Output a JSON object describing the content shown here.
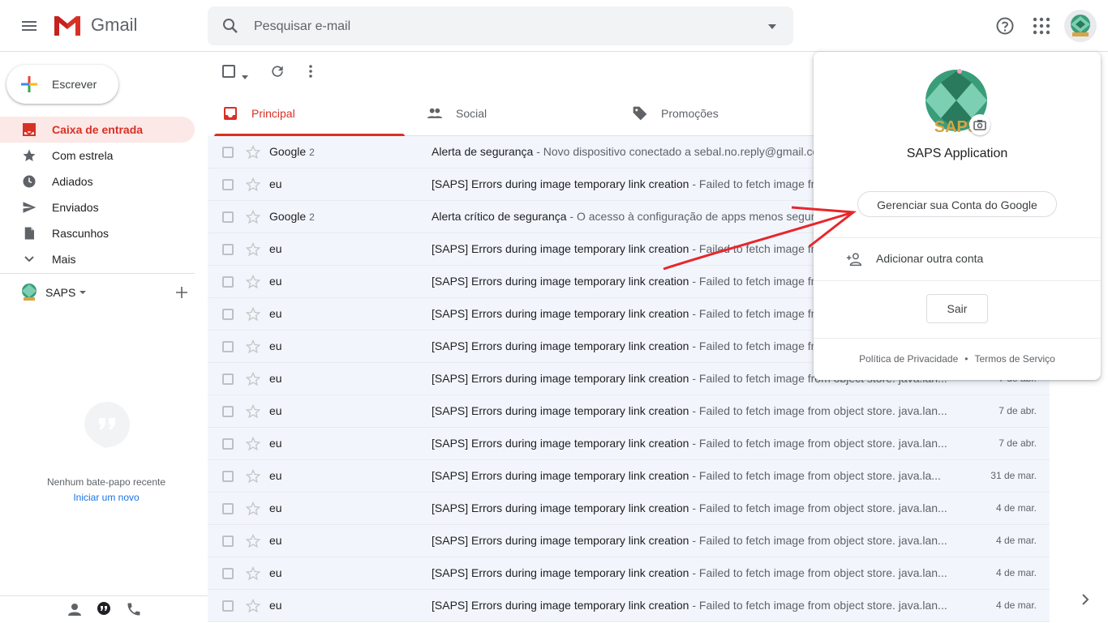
{
  "header": {
    "app_name": "Gmail",
    "search_placeholder": "Pesquisar e-mail"
  },
  "sidebar": {
    "compose_label": "Escrever",
    "items": [
      {
        "label": "Caixa de entrada",
        "icon": "inbox-icon",
        "active": true
      },
      {
        "label": "Com estrela",
        "icon": "star-icon"
      },
      {
        "label": "Adiados",
        "icon": "clock-icon"
      },
      {
        "label": "Enviados",
        "icon": "send-icon"
      },
      {
        "label": "Rascunhos",
        "icon": "draft-icon"
      },
      {
        "label": "Mais",
        "icon": "chevron-down-icon"
      }
    ],
    "account_label": "SAPS",
    "chat_empty": "Nenhum bate-papo recente",
    "chat_new": "Iniciar um novo"
  },
  "tabs": [
    {
      "label": "Principal",
      "icon": "inbox-icon",
      "active": true
    },
    {
      "label": "Social",
      "icon": "people-icon"
    },
    {
      "label": "Promoções",
      "icon": "tag-icon"
    }
  ],
  "emails": [
    {
      "sender": "Google",
      "count": "2",
      "subject": "Alerta de segurança",
      "snippet": " - Novo dispositivo conectado a sebal.no.reply@gmail.com",
      "date": ""
    },
    {
      "sender": "eu",
      "count": "",
      "subject": "[SAPS] Errors during image temporary link creation",
      "snippet": " - Failed to fetch image from object store. java.lan...",
      "date": ""
    },
    {
      "sender": "Google",
      "count": "2",
      "subject": "Alerta crítico de segurança",
      "snippet": " - O acesso à configuração de apps menos seguros",
      "date": ""
    },
    {
      "sender": "eu",
      "count": "",
      "subject": "[SAPS] Errors during image temporary link creation",
      "snippet": " - Failed to fetch image from object store. java.lan...",
      "date": ""
    },
    {
      "sender": "eu",
      "count": "",
      "subject": "[SAPS] Errors during image temporary link creation",
      "snippet": " - Failed to fetch image from object store. java.lan...",
      "date": ""
    },
    {
      "sender": "eu",
      "count": "",
      "subject": "[SAPS] Errors during image temporary link creation",
      "snippet": " - Failed to fetch image from object store. java.lan...",
      "date": ""
    },
    {
      "sender": "eu",
      "count": "",
      "subject": "[SAPS] Errors during image temporary link creation",
      "snippet": " - Failed to fetch image from object store. java.lan...",
      "date": ""
    },
    {
      "sender": "eu",
      "count": "",
      "subject": "[SAPS] Errors during image temporary link creation",
      "snippet": " - Failed to fetch image from object store. java.lan...",
      "date": "7 de abr."
    },
    {
      "sender": "eu",
      "count": "",
      "subject": "[SAPS] Errors during image temporary link creation",
      "snippet": " - Failed to fetch image from object store. java.lan...",
      "date": "7 de abr."
    },
    {
      "sender": "eu",
      "count": "",
      "subject": "[SAPS] Errors during image temporary link creation",
      "snippet": " - Failed to fetch image from object store. java.lan...",
      "date": "7 de abr."
    },
    {
      "sender": "eu",
      "count": "",
      "subject": "[SAPS] Errors during image temporary link creation",
      "snippet": " - Failed to fetch image from object store. java.la...",
      "date": "31 de mar."
    },
    {
      "sender": "eu",
      "count": "",
      "subject": "[SAPS] Errors during image temporary link creation",
      "snippet": " - Failed to fetch image from object store. java.lan...",
      "date": "4 de mar."
    },
    {
      "sender": "eu",
      "count": "",
      "subject": "[SAPS] Errors during image temporary link creation",
      "snippet": " - Failed to fetch image from object store. java.lan...",
      "date": "4 de mar."
    },
    {
      "sender": "eu",
      "count": "",
      "subject": "[SAPS] Errors during image temporary link creation",
      "snippet": " - Failed to fetch image from object store. java.lan...",
      "date": "4 de mar."
    },
    {
      "sender": "eu",
      "count": "",
      "subject": "[SAPS] Errors during image temporary link creation",
      "snippet": " - Failed to fetch image from object store. java.lan...",
      "date": "4 de mar."
    }
  ],
  "account_popup": {
    "avatar_text": "SAPS",
    "name": "SAPS Application",
    "manage_label": "Gerenciar sua Conta do Google",
    "add_account_label": "Adicionar outra conta",
    "signout_label": "Sair",
    "privacy_label": "Política de Privacidade",
    "separator": "•",
    "terms_label": "Termos de Serviço"
  },
  "colors": {
    "accent": "#d93025",
    "link": "#1a73e8",
    "annotation_arrow": "#e8262a"
  }
}
